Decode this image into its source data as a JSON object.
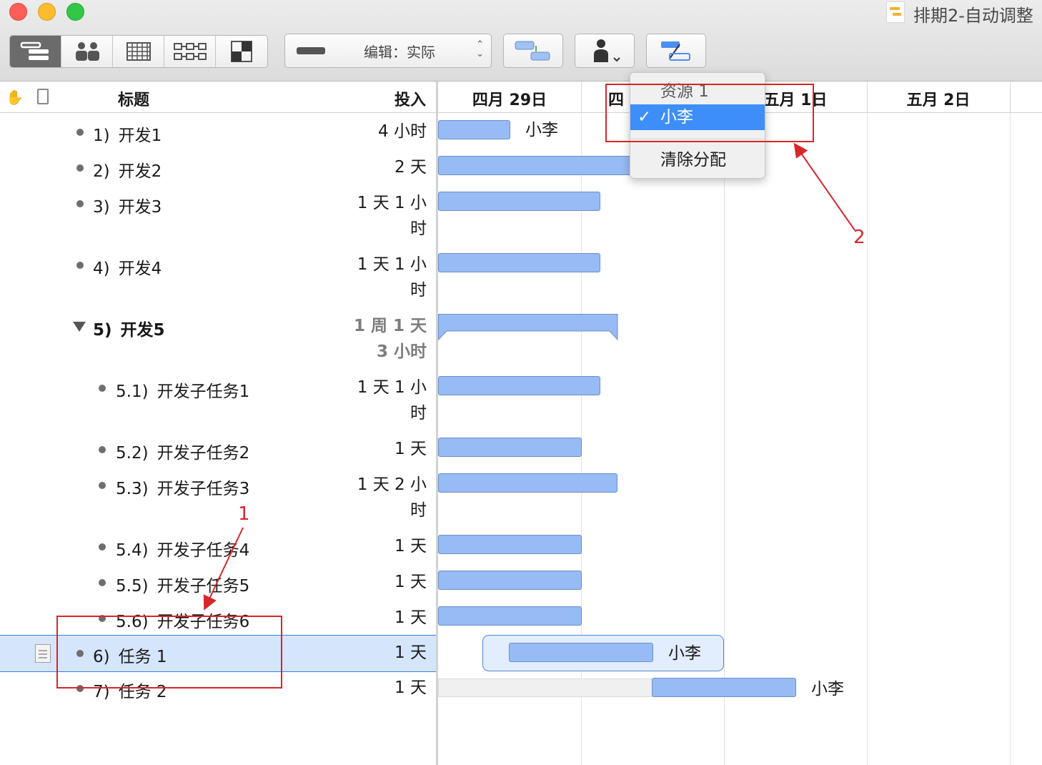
{
  "window": {
    "title": "排期2-自动调整"
  },
  "toolbar": {
    "view_buttons": [
      {
        "name": "gantt-view-icon",
        "glyph": "☰",
        "active": true
      },
      {
        "name": "resource-view-icon",
        "glyph": "👥",
        "active": false
      },
      {
        "name": "calendar-view-icon",
        "glyph": "▦",
        "active": false
      },
      {
        "name": "network-view-icon",
        "glyph": "⧉",
        "active": false
      },
      {
        "name": "styles-view-icon",
        "glyph": "◩",
        "active": false
      }
    ],
    "edit_mode_label": "编辑：实际",
    "icons": {
      "connect": "connect-tasks-icon",
      "assign": "assign-resource-icon",
      "leveling": "level-icon"
    }
  },
  "outline": {
    "columns": {
      "title": "标题",
      "effort": "投入"
    },
    "rows": [
      {
        "num": "1)",
        "title": "开发1",
        "effort": "4 小时",
        "kind": "task"
      },
      {
        "num": "2)",
        "title": "开发2",
        "effort": "2 天",
        "kind": "task"
      },
      {
        "num": "3)",
        "title": "开发3",
        "effort": "1 天 1 小\n时",
        "kind": "task"
      },
      {
        "num": "4)",
        "title": "开发4",
        "effort": "1 天 1 小\n时",
        "kind": "task"
      },
      {
        "num": "5)",
        "title": "开发5",
        "effort": "1 周 1 天\n3 小时",
        "kind": "group"
      },
      {
        "num": "5.1)",
        "title": "开发子任务1",
        "effort": "1 天 1 小\n时",
        "kind": "sub"
      },
      {
        "num": "5.2)",
        "title": "开发子任务2",
        "effort": "1 天",
        "kind": "sub"
      },
      {
        "num": "5.3)",
        "title": "开发子任务3",
        "effort": "1 天 2 小\n时",
        "kind": "sub"
      },
      {
        "num": "5.4)",
        "title": "开发子任务4",
        "effort": "1 天",
        "kind": "sub"
      },
      {
        "num": "5.5)",
        "title": "开发子任务5",
        "effort": "1 天",
        "kind": "sub"
      },
      {
        "num": "5.6)",
        "title": "开发子任务6",
        "effort": "1 天",
        "kind": "sub"
      },
      {
        "num": "6)",
        "title": "任务 1",
        "effort": "1 天",
        "kind": "task",
        "selected": true
      },
      {
        "num": "7)",
        "title": "任务 2",
        "effort": "1 天",
        "kind": "task"
      }
    ]
  },
  "gantt": {
    "days": [
      "四月 29日",
      "四",
      "五月 1日",
      "五月 2日"
    ],
    "assignments": {
      "row1": "小李",
      "row12": "小李",
      "row13": "小李"
    }
  },
  "menu": {
    "header": "资源 1",
    "checked_item": "小李",
    "check_glyph": "✓",
    "clear_item": "清除分配"
  },
  "annotations": {
    "label1": "1",
    "label2": "2",
    "color": "#d8262b"
  },
  "colors": {
    "bar_fill": "#97bbf5",
    "selection": "#d5e5fb",
    "menu_highlight": "#3d8ef8"
  }
}
